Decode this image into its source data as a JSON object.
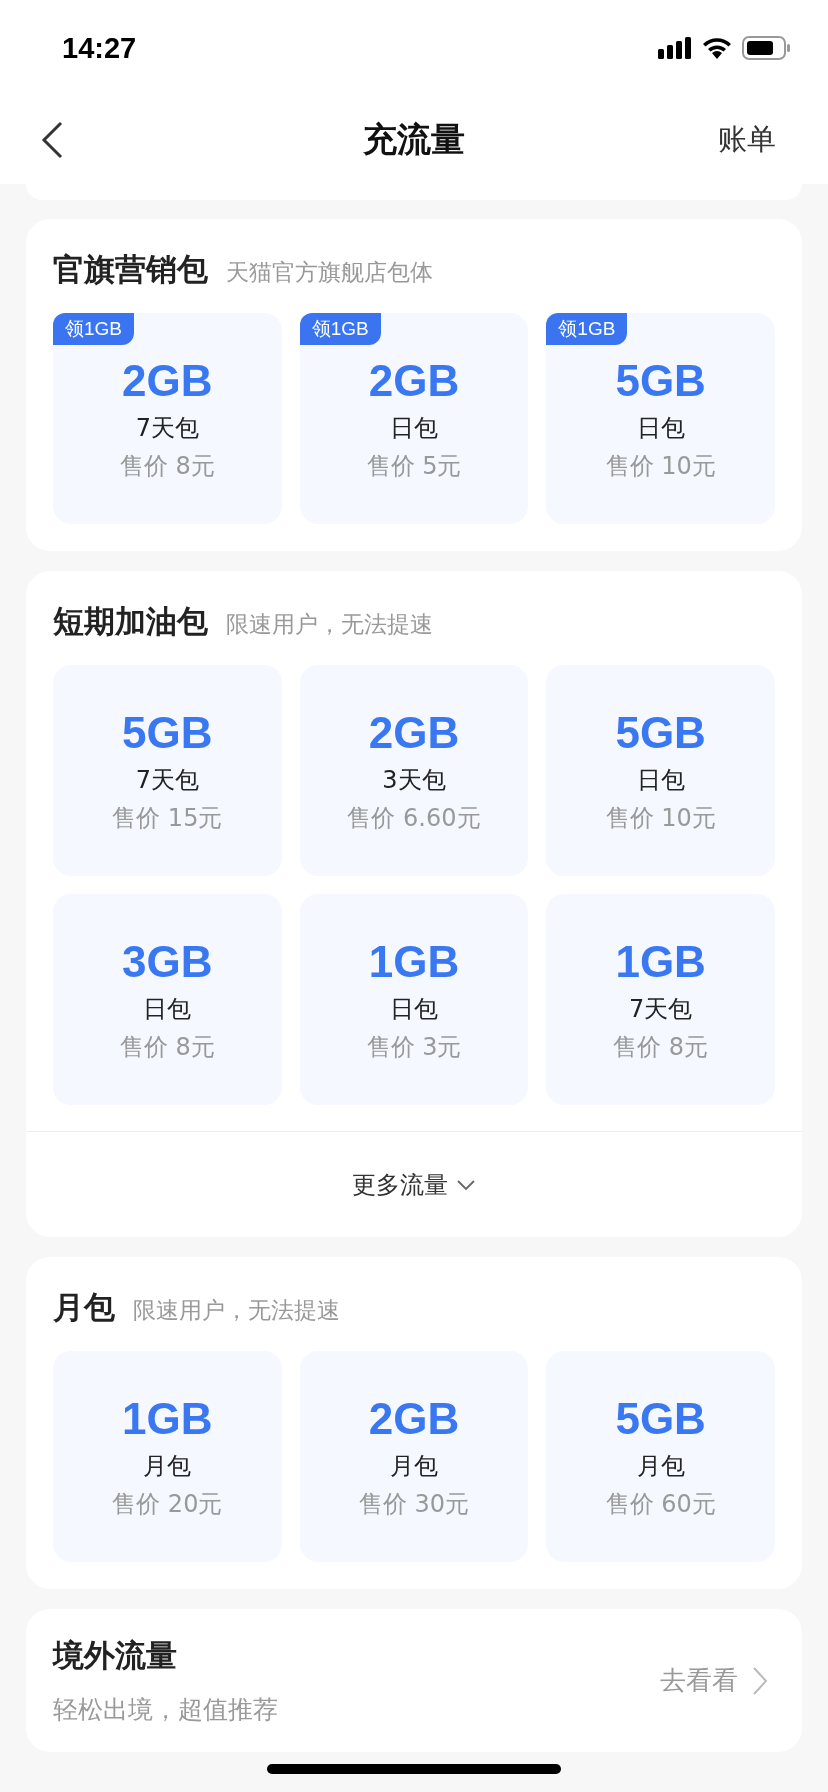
{
  "status_bar": {
    "time": "14:27"
  },
  "nav": {
    "title": "充流量",
    "action": "账单"
  },
  "sections": [
    {
      "title": "官旗营销包",
      "subtitle": "天猫官方旗舰店包体",
      "tiles": [
        {
          "badge": "领1GB",
          "size": "2GB",
          "period": "7天包",
          "price": "售价 8元"
        },
        {
          "badge": "领1GB",
          "size": "2GB",
          "period": "日包",
          "price": "售价 5元"
        },
        {
          "badge": "领1GB",
          "size": "5GB",
          "period": "日包",
          "price": "售价 10元"
        }
      ]
    },
    {
      "title": "短期加油包",
      "subtitle": "限速用户，无法提速",
      "tiles": [
        {
          "size": "5GB",
          "period": "7天包",
          "price": "售价 15元"
        },
        {
          "size": "2GB",
          "period": "3天包",
          "price": "售价 6.60元"
        },
        {
          "size": "5GB",
          "period": "日包",
          "price": "售价 10元"
        },
        {
          "size": "3GB",
          "period": "日包",
          "price": "售价 8元"
        },
        {
          "size": "1GB",
          "period": "日包",
          "price": "售价 3元"
        },
        {
          "size": "1GB",
          "period": "7天包",
          "price": "售价 8元"
        }
      ],
      "more": "更多流量"
    },
    {
      "title": "月包",
      "subtitle": "限速用户，无法提速",
      "tiles": [
        {
          "size": "1GB",
          "period": "月包",
          "price": "售价 20元"
        },
        {
          "size": "2GB",
          "period": "月包",
          "price": "售价 30元"
        },
        {
          "size": "5GB",
          "period": "月包",
          "price": "售价 60元"
        }
      ]
    }
  ],
  "overseas": {
    "title": "境外流量",
    "subtitle": "轻松出境，超值推荐",
    "action": "去看看"
  }
}
